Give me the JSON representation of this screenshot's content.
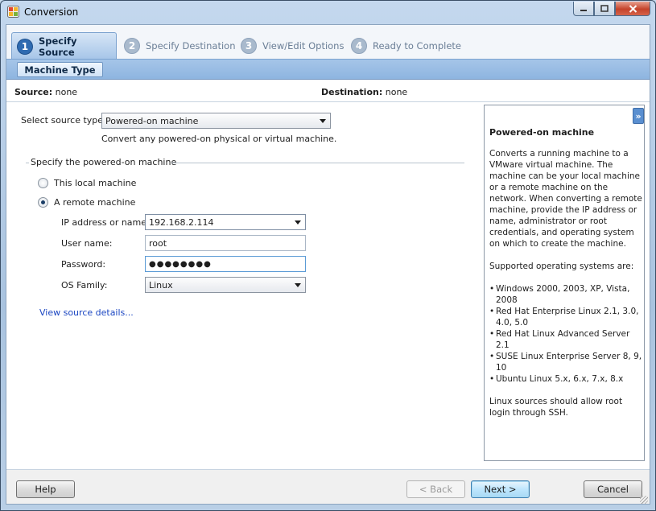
{
  "window": {
    "title": "Conversion",
    "icon": "app-icon"
  },
  "steps": [
    {
      "number": "1",
      "label": "Specify Source",
      "active": true
    },
    {
      "number": "2",
      "label": "Specify Destination",
      "active": false
    },
    {
      "number": "3",
      "label": "View/Edit Options",
      "active": false
    },
    {
      "number": "4",
      "label": "Ready to Complete",
      "active": false
    }
  ],
  "subtab": {
    "label": "Machine Type"
  },
  "summary": {
    "source_label": "Source:",
    "source_value": "none",
    "destination_label": "Destination:",
    "destination_value": "none"
  },
  "source_type": {
    "label": "Select source type:",
    "value": "Powered-on machine",
    "description": "Convert any powered-on physical or virtual machine."
  },
  "group": {
    "title": "Specify the powered-on machine",
    "local_label": "This local machine",
    "remote_label": "A remote machine",
    "selected": "remote"
  },
  "fields": {
    "ip_label": "IP address or name:",
    "ip_value": "192.168.2.114",
    "user_label": "User name:",
    "user_value": "root",
    "password_label": "Password:",
    "password_value": "●●●●●●●●",
    "os_label": "OS Family:",
    "os_value": "Linux"
  },
  "link": {
    "view_details": "View source details..."
  },
  "help": {
    "collapse": "»",
    "title": "Powered-on machine",
    "intro": "Converts a running machine to a VMware virtual machine. The machine can be your local machine or a remote machine on the network. When converting a remote machine, provide the IP address or name, administrator or root credentials, and operating system on which to create the machine.",
    "supported_heading": "Supported operating systems are:",
    "os_list": [
      "Windows 2000, 2003, XP, Vista, 2008",
      "Red Hat Enterprise Linux 2.1, 3.0, 4.0, 5.0",
      "Red Hat Linux Advanced Server 2.1",
      "SUSE Linux Enterprise Server 8, 9, 10",
      "Ubuntu Linux 5.x, 6.x, 7.x, 8.x"
    ],
    "note": "Linux sources should allow root login through SSH."
  },
  "footer": {
    "help": "Help",
    "back": "< Back",
    "next": "Next >",
    "cancel": "Cancel"
  }
}
